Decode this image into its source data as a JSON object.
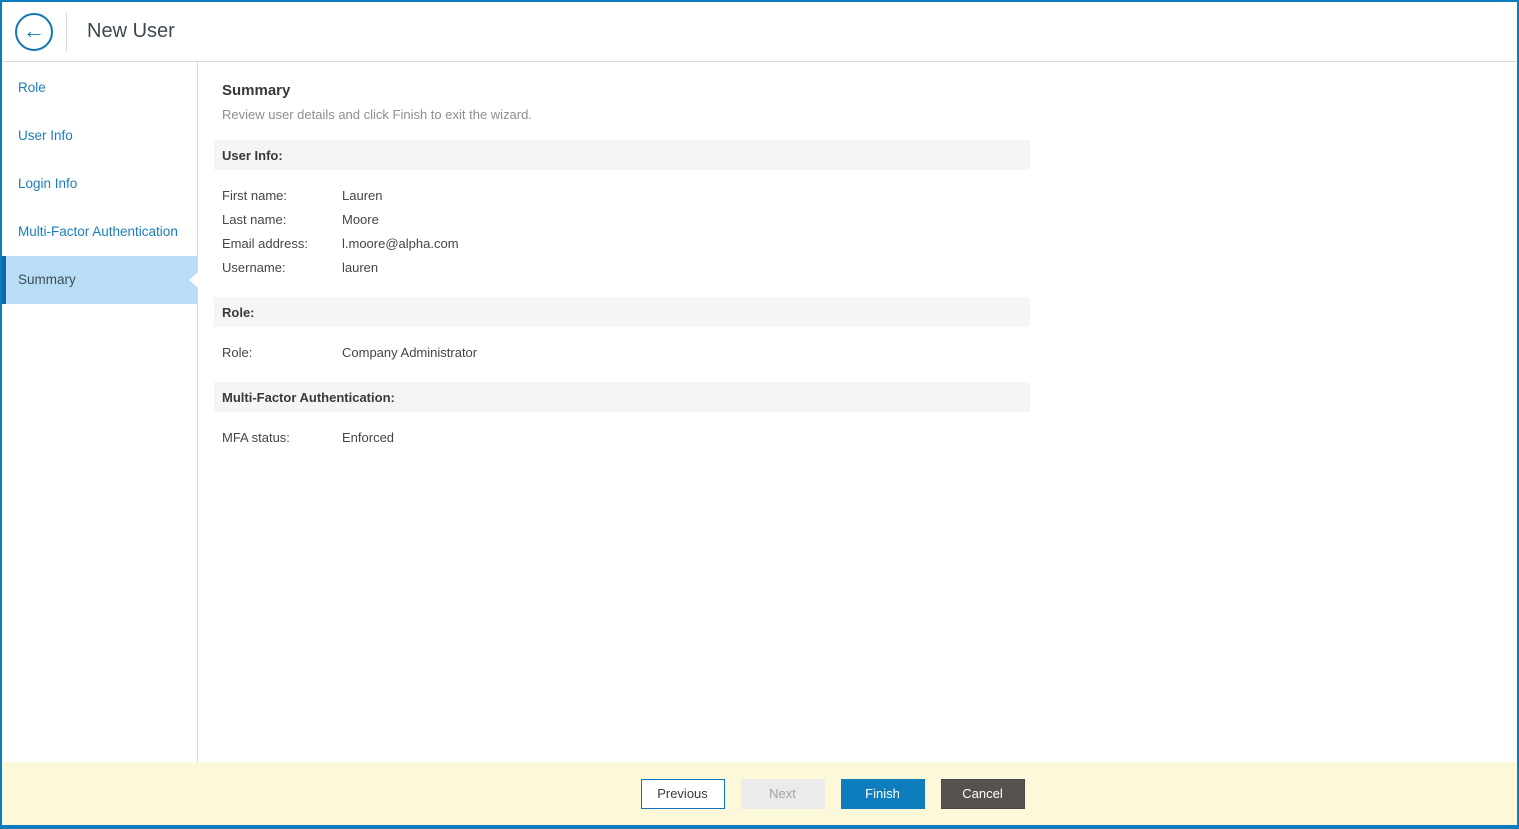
{
  "window": {
    "title": "New User",
    "back_icon": "arrow-left-icon",
    "back_glyph": "←"
  },
  "colors": {
    "frame_accent": "#0b7cbd",
    "link_blue": "#1a7dbd",
    "active_item_bg": "#b9ddf6",
    "active_item_accent": "#0c6ba5",
    "section_bar_bg": "#f5f5f5",
    "footer_bg": "#fcf8da",
    "primary_button_bg": "#0d7dbe",
    "cancel_button_bg": "#56524e",
    "disabled_button_bg": "#ebebeb"
  },
  "sidebar": {
    "items": [
      {
        "label": "Role",
        "active": false
      },
      {
        "label": "User Info",
        "active": false
      },
      {
        "label": "Login Info",
        "active": false
      },
      {
        "label": "Multi-Factor Authentication",
        "active": false
      },
      {
        "label": "Summary",
        "active": true
      }
    ]
  },
  "main": {
    "heading": "Summary",
    "subheading": "Review user details and click Finish to exit the wizard.",
    "sections": [
      {
        "title": "User Info:",
        "rows": [
          {
            "label": "First name:",
            "value": "Lauren"
          },
          {
            "label": "Last name:",
            "value": "Moore"
          },
          {
            "label": "Email address:",
            "value": "l.moore@alpha.com"
          },
          {
            "label": "Username:",
            "value": "lauren"
          }
        ]
      },
      {
        "title": "Role:",
        "rows": [
          {
            "label": "Role:",
            "value": "Company Administrator"
          }
        ]
      },
      {
        "title": "Multi-Factor Authentication:",
        "rows": [
          {
            "label": "MFA status:",
            "value": "Enforced"
          }
        ]
      }
    ]
  },
  "footer": {
    "buttons": [
      {
        "label": "Previous",
        "style": "secondary",
        "enabled": true
      },
      {
        "label": "Next",
        "style": "disabled",
        "enabled": false
      },
      {
        "label": "Finish",
        "style": "primary",
        "enabled": true
      },
      {
        "label": "Cancel",
        "style": "dark",
        "enabled": true
      }
    ]
  }
}
